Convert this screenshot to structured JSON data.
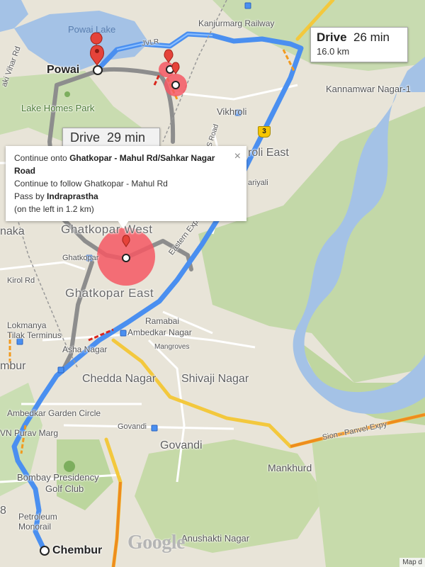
{
  "map": {
    "route_primary": {
      "mode": "Drive",
      "duration": "26 min",
      "distance": "16.0 km"
    },
    "route_alternate": {
      "text": "Drive  29 min"
    },
    "info_bubble": {
      "line1_prefix": "Continue onto ",
      "line1_bold": "Ghatkopar - Mahul Rd/Sahkar Nagar Road",
      "line2": "Continue to follow Ghatkopar - Mahul Rd",
      "line3_prefix": "Pass by ",
      "line3_bold": "Indraprastha",
      "line4": "(on the left in 1.2 km)",
      "close_glyph": "×"
    },
    "origin_label": "Powai",
    "destination_label": "Chembur",
    "places": {
      "powai_lake": "Powai Lake",
      "kanjurmarg_railway": "Kanjurmarg Railway",
      "jvlr": "JVLR",
      "kannamwar": "Kannamwar Nagar-1",
      "lake_homes": "Lake Homes Park",
      "vikhroli": "Vikhroli",
      "s_road": "S Road",
      "vikhroli_east": "roli East",
      "hariyali": "ariyali",
      "ghatkopar_west": "Ghatkopar West",
      "ghatkopar_station": "Ghatkopar",
      "kirol": "Kirol Rd",
      "ghatkopar_east": "Ghatkopar East",
      "eastern_expy": "Eastern Express H",
      "ramabai": "Ramabai",
      "ambedkar": "Ambedkar Nagar",
      "mangroves": "Mangroves",
      "lokmanya": "Lokmanya",
      "tilak": "Tilak Terminus",
      "asha": "Asha Nagar",
      "chembur_w": "mbur",
      "chedda": "Chedda Nagar",
      "shivaji": "Shivaji Nagar",
      "ambedkar_garden": "Ambedkar Garden Circle",
      "govandi_st": "Govandi",
      "purav": "VN Purav Marg",
      "govandi": "Govandi",
      "sion_panvel": "Sion - Panvel Expy",
      "mankhurd": "Mankhurd",
      "bombay_pres": "Bombay Presidency",
      "golf": "Golf Club",
      "petroleum": "Petroleum",
      "monorail": "Monorail",
      "anushakti": "Anushakti Nagar",
      "naka": "naka",
      "vihar": "aki Vihar Rd",
      "eight": "8"
    },
    "highway_shield": "3",
    "logo": "Google",
    "map_data": "Map d"
  },
  "colors": {
    "route": "#4a8ff0",
    "route_alt": "#8d8d8d",
    "marker": "#e5433a",
    "water": "#a4c2e6",
    "park": "#b9d7a0",
    "land": "#e8e4d8",
    "highway": "#f7c600",
    "arterial": "#ffffff",
    "traffic_red": "#d9261c",
    "traffic_orange": "#f29a1e"
  }
}
